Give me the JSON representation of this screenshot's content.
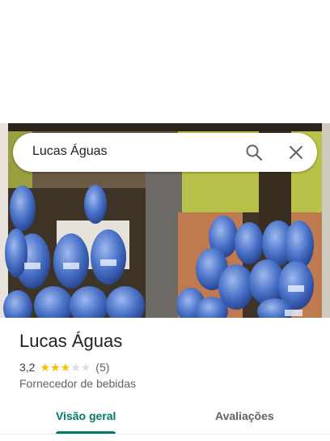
{
  "search": {
    "query": "Lucas Águas"
  },
  "place": {
    "name": "Lucas Águas",
    "rating": "3,2",
    "stars": 3.2,
    "reviews": "(5)",
    "category": "Fornecedor de bebidas"
  },
  "tabs": [
    {
      "label": "Visão geral",
      "active": true
    },
    {
      "label": "Avaliações",
      "active": false
    }
  ],
  "colors": {
    "accent": "#00796b",
    "star": "#fbbc04",
    "star_empty": "#dadce0",
    "text_secondary": "#5f6368"
  }
}
